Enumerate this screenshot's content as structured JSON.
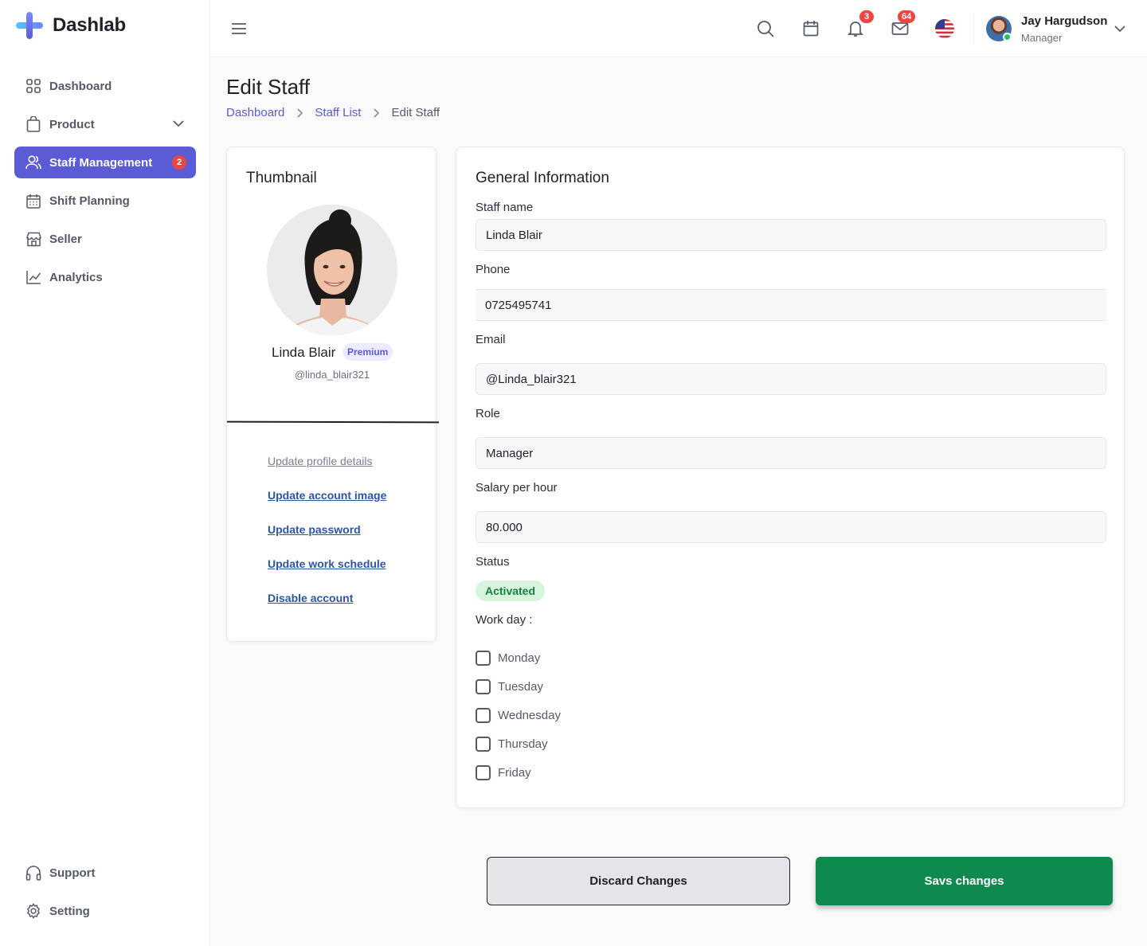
{
  "app": {
    "name": "Dashlab"
  },
  "sidebar": {
    "items": [
      {
        "label": "Dashboard",
        "icon": "grid-icon"
      },
      {
        "label": "Product",
        "icon": "shopping-bag-icon",
        "expandable": true
      },
      {
        "label": "Staff Management",
        "icon": "users-icon",
        "active": true,
        "badge": "2"
      },
      {
        "label": "Shift Planning",
        "icon": "calendar-grid-icon"
      },
      {
        "label": "Seller",
        "icon": "store-icon"
      },
      {
        "label": "Analytics",
        "icon": "line-chart-icon"
      }
    ],
    "bottom_items": [
      {
        "label": "Support",
        "icon": "headphones-icon"
      },
      {
        "label": "Setting",
        "icon": "gear-icon"
      }
    ]
  },
  "topbar": {
    "notifications_count": "3",
    "messages_count": "64",
    "language_flag": "us-flag-icon",
    "user": {
      "name": "Jay Hargudson",
      "role": "Manager",
      "online": true
    }
  },
  "page": {
    "title": "Edit Staff",
    "breadcrumb": [
      "Dashboard",
      "Staff List",
      "Edit Staff"
    ]
  },
  "thumbnail": {
    "title": "Thumbnail",
    "name": "Linda Blair",
    "tier": "Premium",
    "handle": "@linda_blair321",
    "links": [
      "Update profile details",
      "Update account image",
      "Update password",
      "Update work schedule",
      "Disable account"
    ]
  },
  "general": {
    "title": "General Information",
    "fields": {
      "staff_name": {
        "label": "Staff name",
        "value": "Linda Blair"
      },
      "phone": {
        "label": "Phone",
        "value": "0725495741"
      },
      "email": {
        "label": "Email",
        "value": "@Linda_blair321"
      },
      "role": {
        "label": "Role",
        "value": "Manager"
      },
      "salary": {
        "label": "Salary per hour",
        "value": "80.000"
      }
    },
    "status": {
      "label": "Status",
      "value": "Activated"
    },
    "workday": {
      "label": "Work day :",
      "days": [
        "Monday",
        "Tuesday",
        "Wednesday",
        "Thursday",
        "Friday"
      ]
    }
  },
  "actions": {
    "discard": "Discard Changes",
    "save": "Savs changes"
  },
  "colors": {
    "accent": "#5b5bd6",
    "danger": "#ef4444",
    "success": "#0e8a4f",
    "status_bg": "#d6f5dc"
  }
}
